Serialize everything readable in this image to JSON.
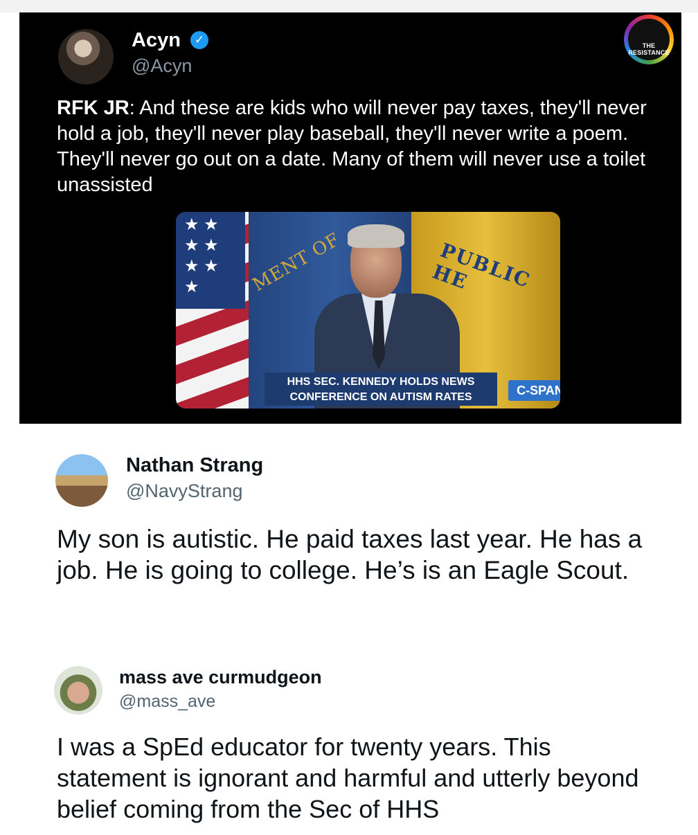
{
  "original_tweet": {
    "author_name": "Acyn",
    "author_handle": "@Acyn",
    "verified_mark": "✓",
    "badge_text": "THE RESISTANCE",
    "speaker_label": "RFK JR",
    "text": ": And these are kids who will never pay taxes, they'll never hold a job, they'll never play baseball, they'll never write a poem. They'll never go out on a date. Many of them will never use a toilet unassisted",
    "video": {
      "chyron_line1": "HHS SEC. KENNEDY HOLDS NEWS",
      "chyron_line2": "CONFERENCE ON AUTISM RATES",
      "network": "C-SPAN",
      "seal_left_text": "MENT OF",
      "seal_right_text": "PUBLIC HE"
    }
  },
  "replies": [
    {
      "author_name": "Nathan Strang",
      "author_handle": "@NavyStrang",
      "text": "My son is autistic. He paid taxes last year. He has a job. He is going to college. He’s is an Eagle Scout."
    },
    {
      "author_name": "mass ave curmudgeon",
      "author_handle": "@mass_ave",
      "text": "I was a SpEd educator for twenty years. This statement is ignorant and harmful and utterly beyond belief coming from the Sec of HHS"
    }
  ],
  "icons": {
    "verified": "verified-badge-icon",
    "resistance": "resistance-logo-icon"
  },
  "colors": {
    "dark_background": "#000000",
    "light_background": "#ffffff",
    "handle_gray_dark": "#8b98a5",
    "handle_gray_light": "#536471",
    "verified_blue": "#1d9bf0",
    "chyron_blue": "#1e3b70"
  }
}
